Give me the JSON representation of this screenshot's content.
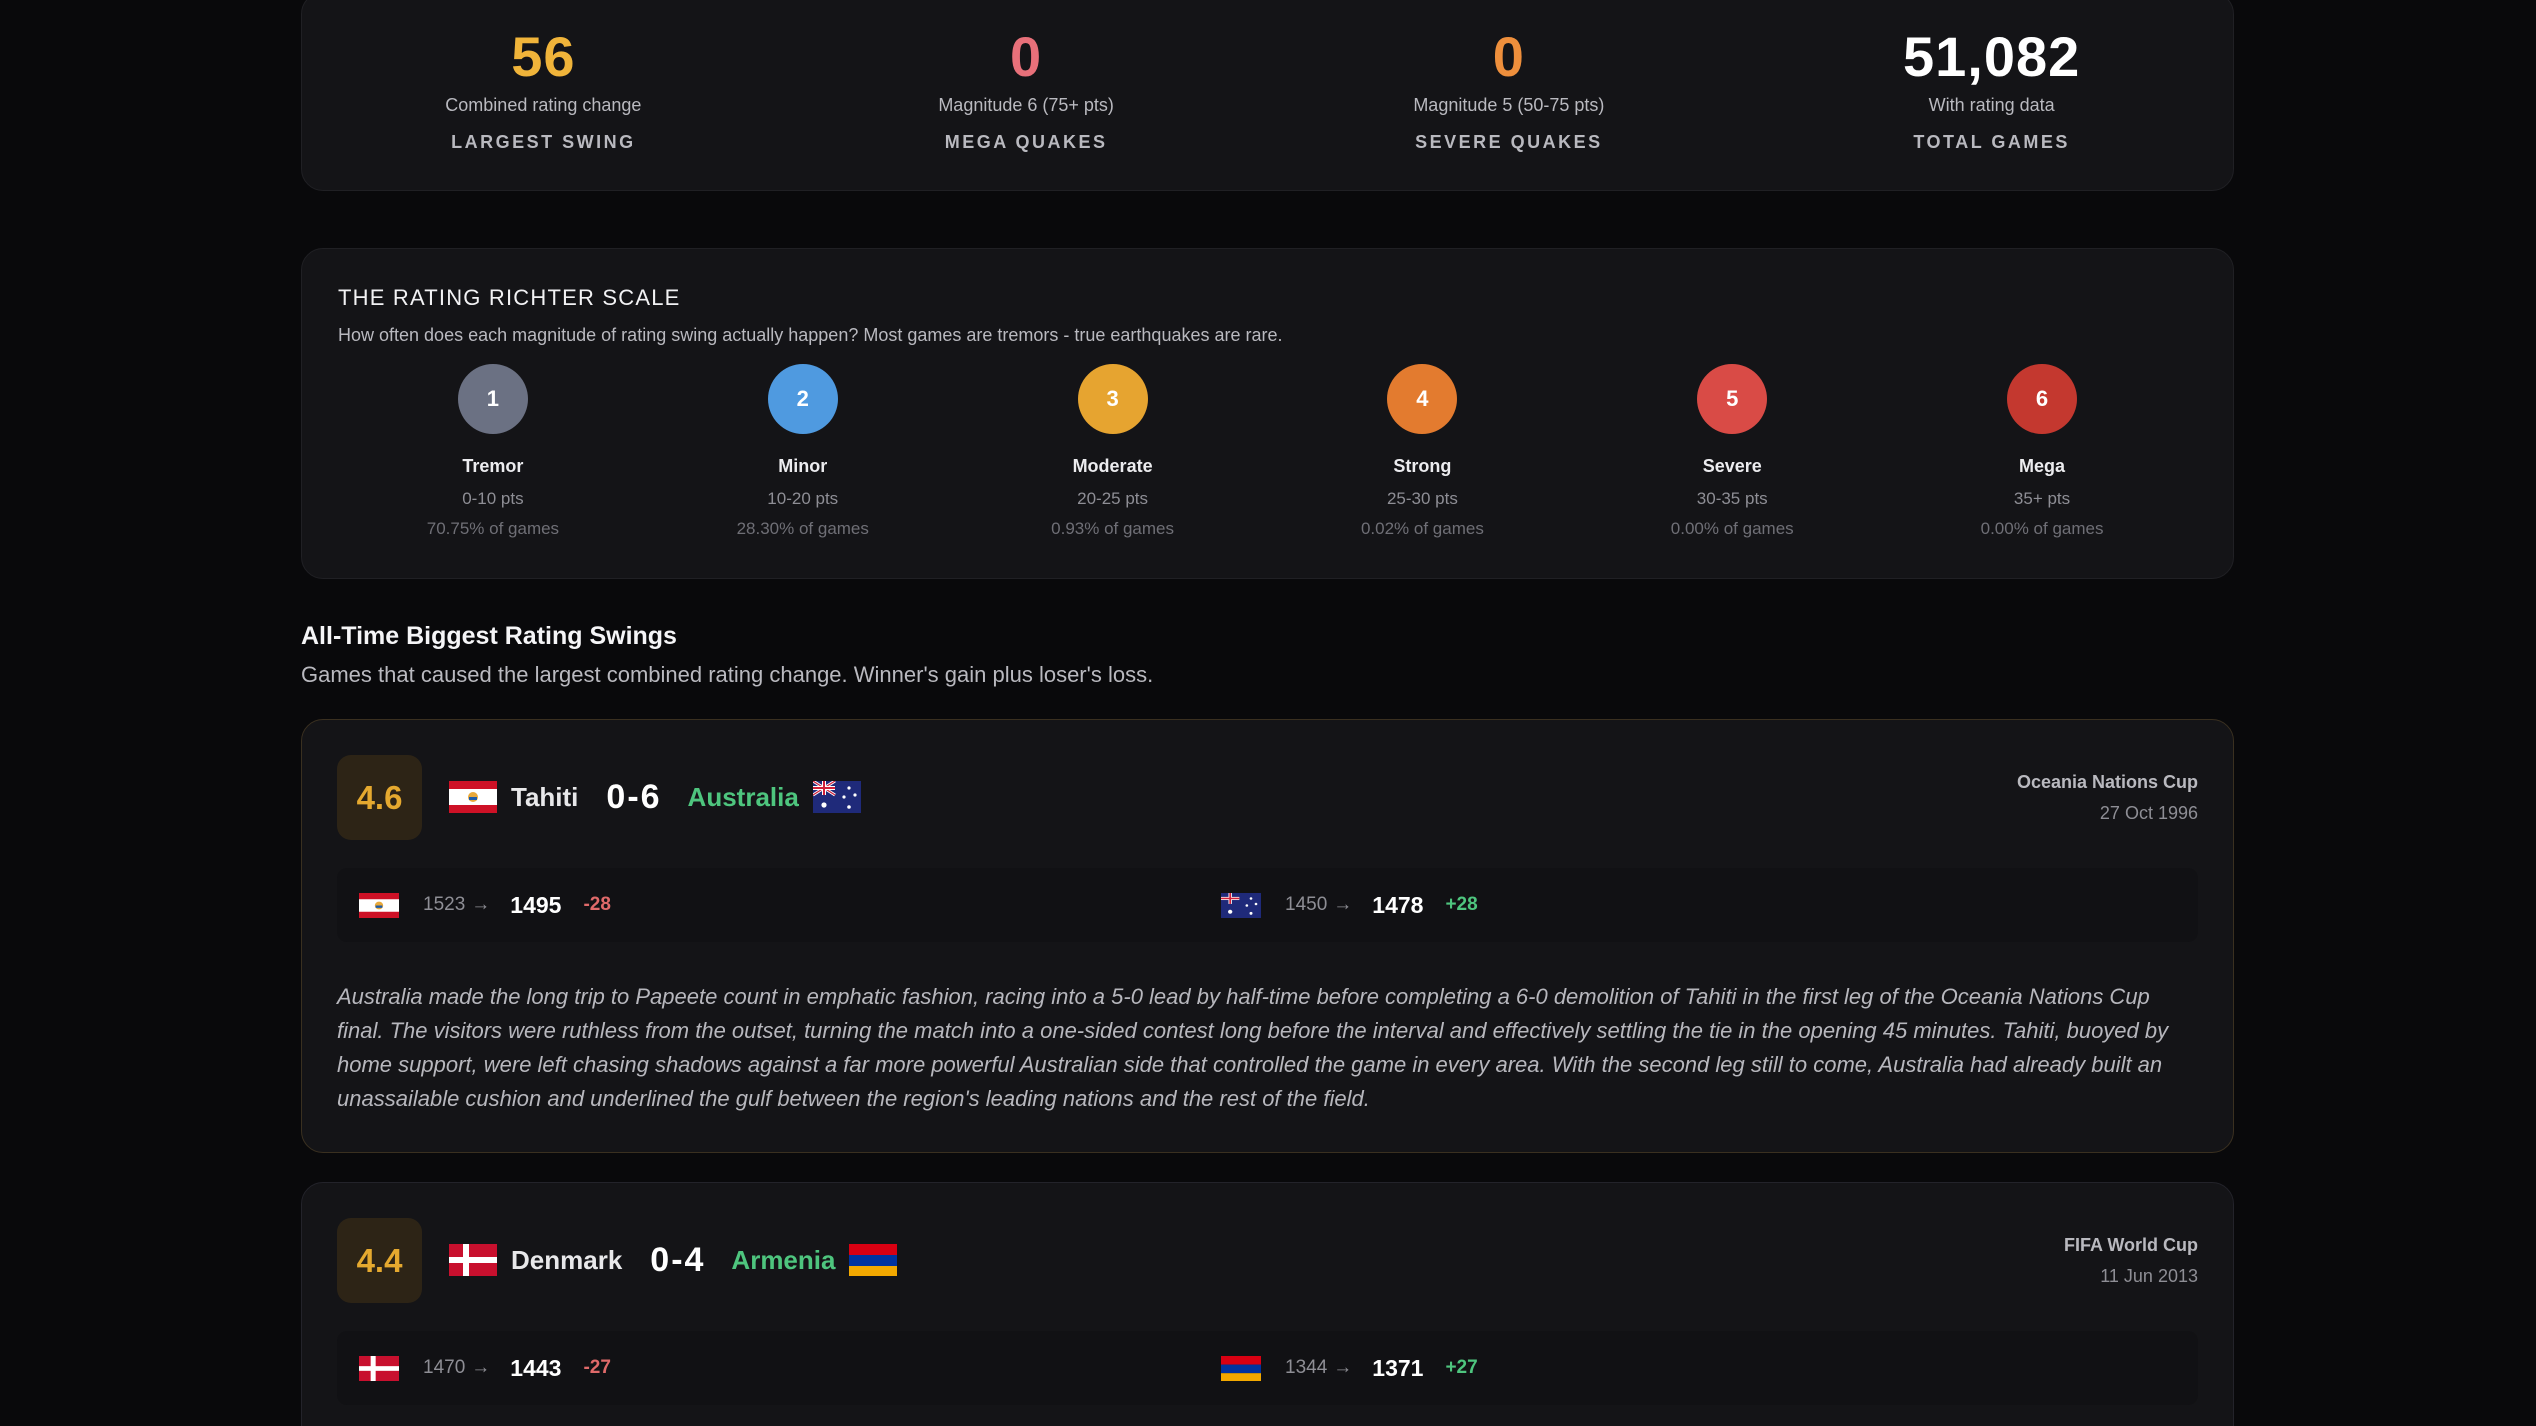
{
  "stats": [
    {
      "value": "56",
      "sub": "Combined rating change",
      "label": "LARGEST SWING",
      "color": "#f0b43a"
    },
    {
      "value": "0",
      "sub": "Magnitude 6 (75+ pts)",
      "label": "MEGA QUAKES",
      "color": "#e8707a"
    },
    {
      "value": "0",
      "sub": "Magnitude 5 (50-75 pts)",
      "label": "SEVERE QUAKES",
      "color": "#ee8f3c"
    },
    {
      "value": "51,082",
      "sub": "With rating data",
      "label": "TOTAL GAMES",
      "color": "#ffffff"
    }
  ],
  "scale": {
    "title": "THE RATING RICHTER SCALE",
    "description": "How often does each magnitude of rating swing actually happen? Most games are tremors - true earthquakes are rare.",
    "levels": [
      {
        "num": "1",
        "name": "Tremor",
        "range": "0-10 pts",
        "pct": "70.75% of games",
        "color": "#6b7183"
      },
      {
        "num": "2",
        "name": "Minor",
        "range": "10-20 pts",
        "pct": "28.30% of games",
        "color": "#4f9ae0"
      },
      {
        "num": "3",
        "name": "Moderate",
        "range": "20-25 pts",
        "pct": "0.93% of games",
        "color": "#e6a430"
      },
      {
        "num": "4",
        "name": "Strong",
        "range": "25-30 pts",
        "pct": "0.02% of games",
        "color": "#e37b2f"
      },
      {
        "num": "5",
        "name": "Severe",
        "range": "30-35 pts",
        "pct": "0.00% of games",
        "color": "#d94b46"
      },
      {
        "num": "6",
        "name": "Mega",
        "range": "35+ pts",
        "pct": "0.00% of games",
        "color": "#c4382f"
      }
    ]
  },
  "section": {
    "title": "All-Time Biggest Rating Swings",
    "description": "Games that caused the largest combined rating change. Winner's gain plus loser's loss."
  },
  "matches": [
    {
      "magnitude": "4.6",
      "home": "Tahiti",
      "score": "0-6",
      "away": "Australia",
      "home_flag": "tahiti-flag",
      "away_flag": "australia-flag",
      "competition": "Oceania Nations Cup",
      "date": "27 Oct 1996",
      "home_old": "1523",
      "home_new": "1495",
      "home_delta": "-28",
      "away_old": "1450",
      "away_new": "1478",
      "away_delta": "+28",
      "arrow": "→",
      "narrative": "Australia made the long trip to Papeete count in emphatic fashion, racing into a 5-0 lead by half-time before completing a 6-0 demolition of Tahiti in the first leg of the Oceania Nations Cup final. The visitors were ruthless from the outset, turning the match into a one-sided contest long before the interval and effectively settling the tie in the opening 45 minutes. Tahiti, buoyed by home support, were left chasing shadows against a far more powerful Australian side that controlled the game in every area. With the second leg still to come, Australia had already built an unassailable cushion and underlined the gulf between the region's leading nations and the rest of the field."
    },
    {
      "magnitude": "4.4",
      "home": "Denmark",
      "score": "0-4",
      "away": "Armenia",
      "home_flag": "denmark-flag",
      "away_flag": "armenia-flag",
      "competition": "FIFA World Cup",
      "date": "11 Jun 2013",
      "home_old": "1470",
      "home_new": "1443",
      "home_delta": "-27",
      "away_old": "1344",
      "away_new": "1371",
      "away_delta": "+27",
      "arrow": "→"
    }
  ]
}
